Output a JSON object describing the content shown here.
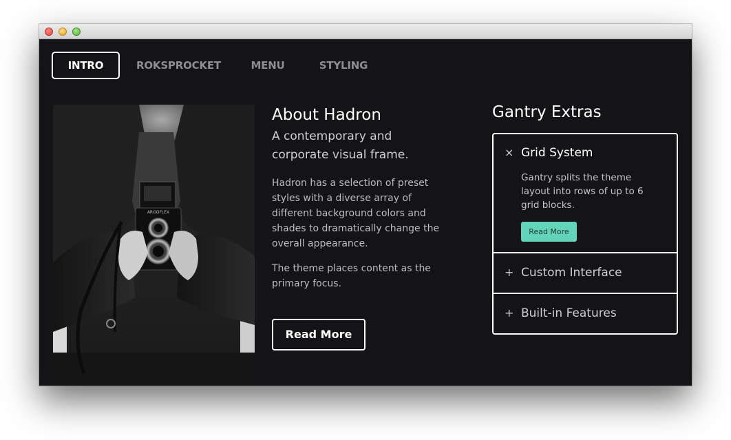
{
  "nav": {
    "items": [
      {
        "label": "INTRO",
        "active": true
      },
      {
        "label": "ROKSPROCKET",
        "active": false
      },
      {
        "label": "MENU",
        "active": false
      },
      {
        "label": "STYLING",
        "active": false
      }
    ]
  },
  "about": {
    "title": "About Hadron",
    "subtitle": "A contemporary and corporate visual frame.",
    "paragraphs": [
      "Hadron has a selection of preset styles with a diverse array of different background colors and shades to dramatically change the overall appearance.",
      "The theme places content as the primary focus."
    ],
    "button_label": "Read More"
  },
  "photo": {
    "subject": "man holding twin-lens reflex camera",
    "camera_brand": "ARGOFLEX"
  },
  "extras": {
    "title": "Gantry Extras",
    "items": [
      {
        "icon": "close-icon",
        "glyph": "×",
        "title": "Grid System",
        "expanded": true,
        "body": "Gantry splits the theme layout into rows of up to 6 grid blocks.",
        "button_label": "Read More"
      },
      {
        "icon": "plus-icon",
        "glyph": "+",
        "title": "Custom Interface",
        "expanded": false
      },
      {
        "icon": "plus-icon",
        "glyph": "+",
        "title": "Built-in Features",
        "expanded": false
      }
    ]
  },
  "colors": {
    "background": "#141417",
    "accent": "#63d3b9",
    "text": "#ffffff",
    "muted": "#8d8d92"
  }
}
